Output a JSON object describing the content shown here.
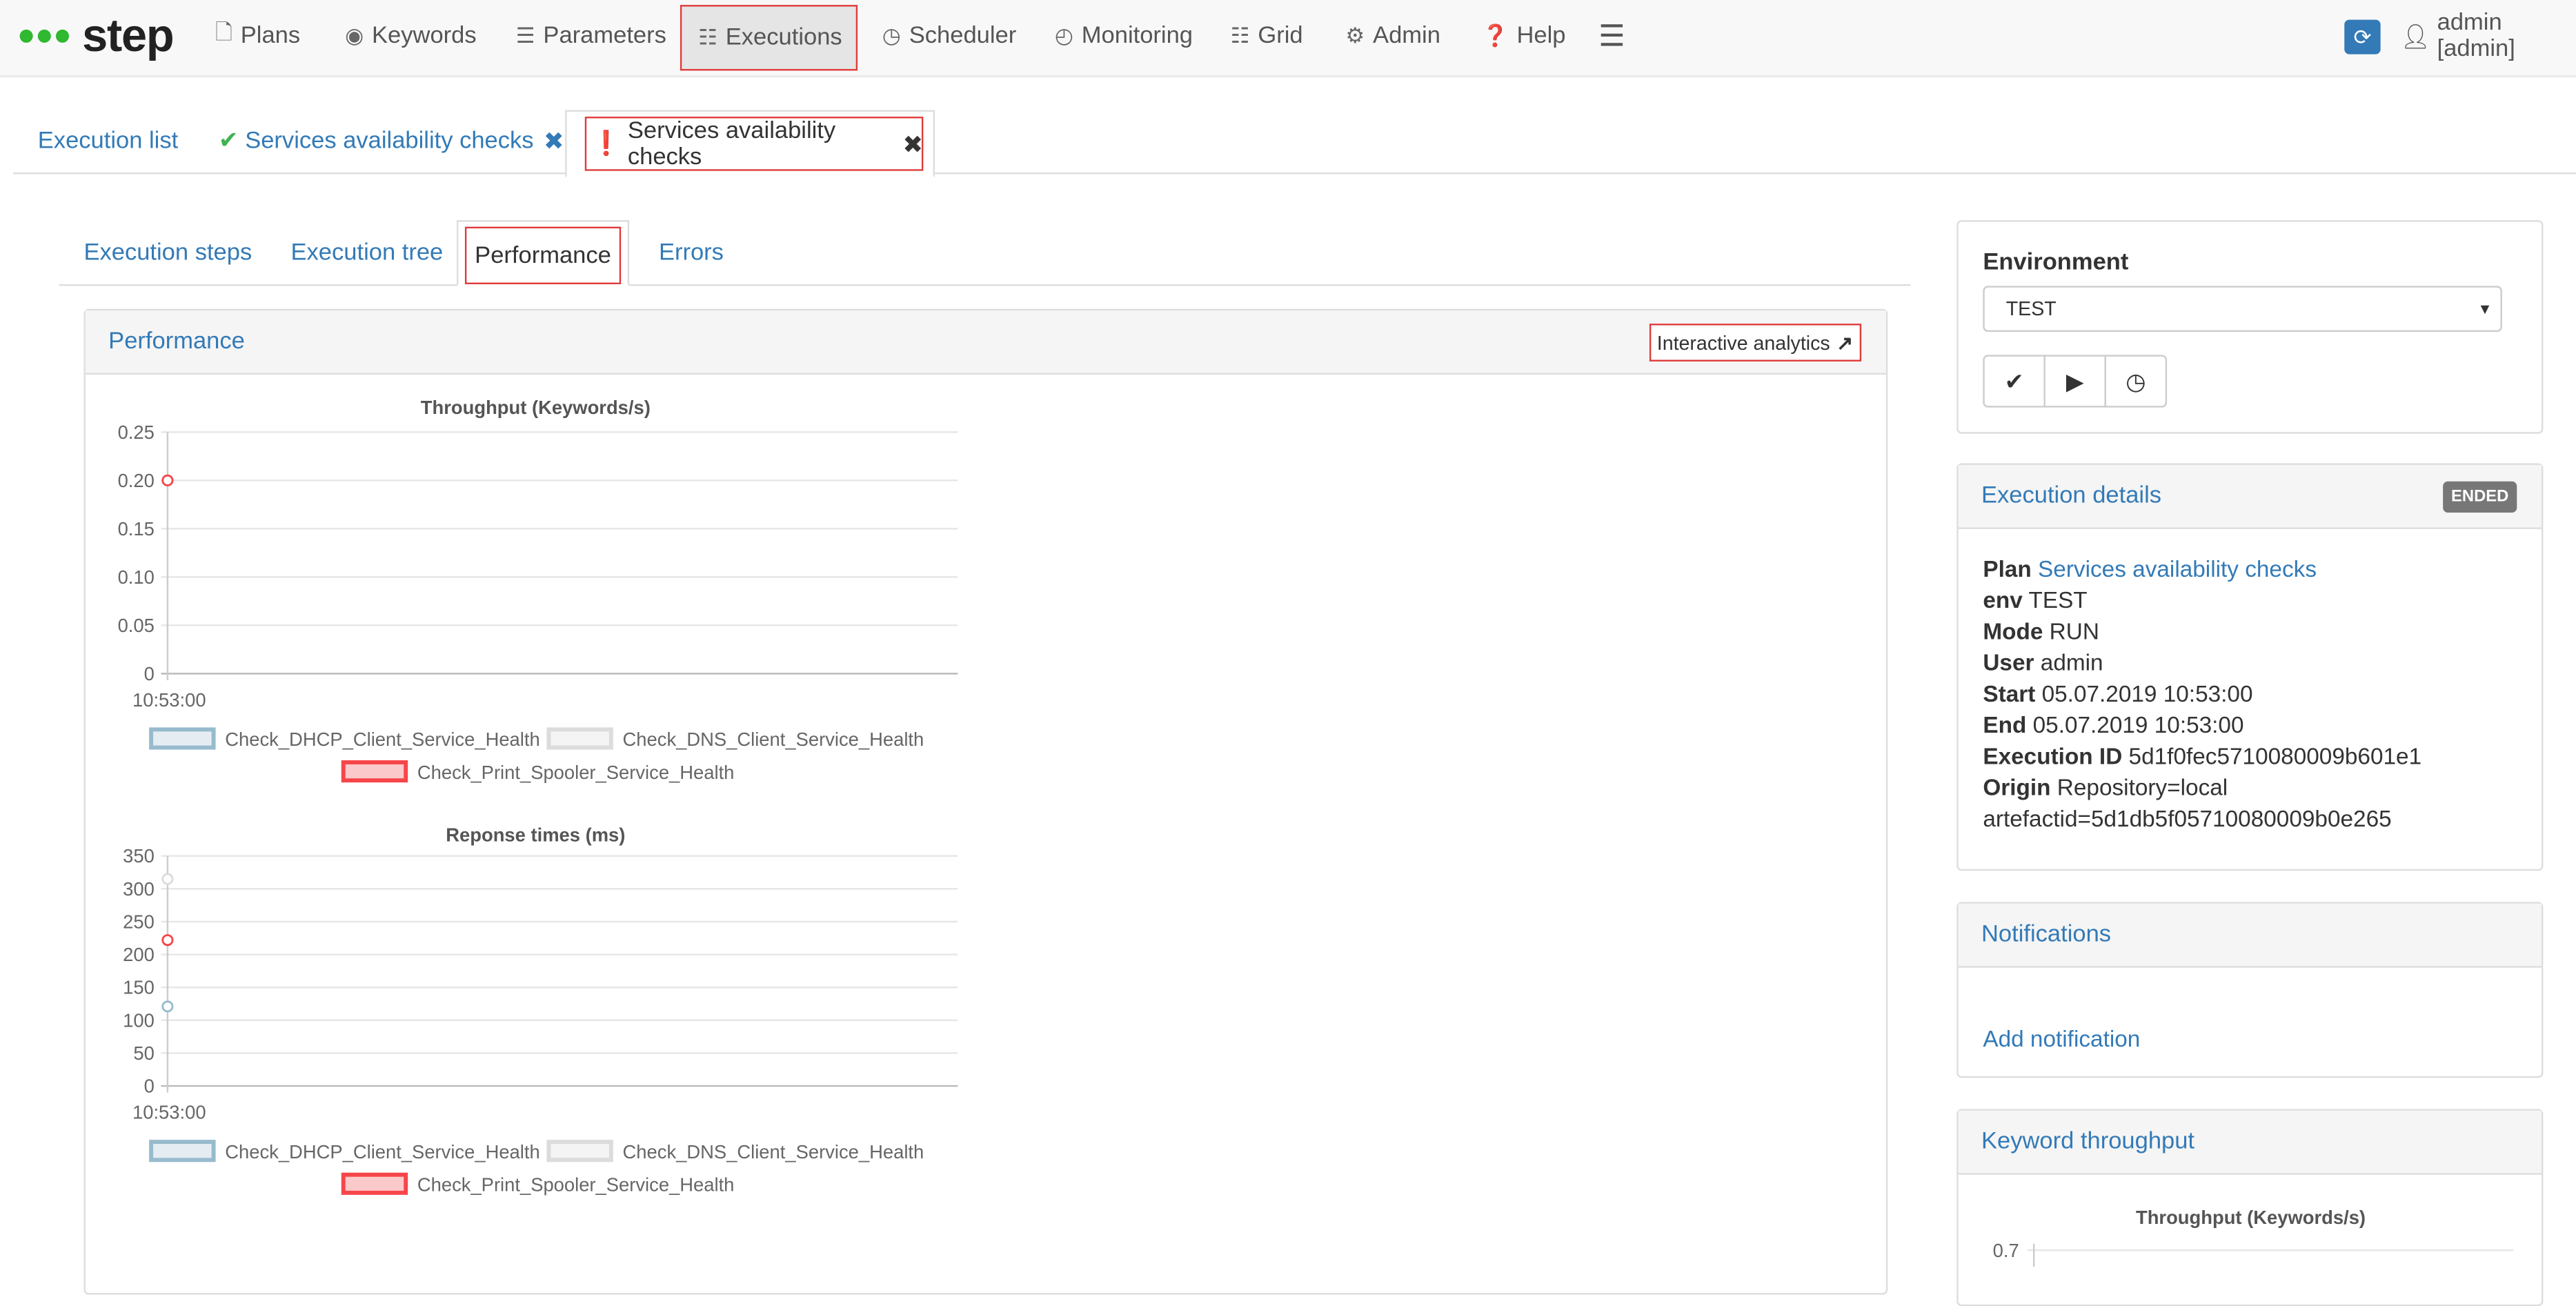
{
  "brand": {
    "name": "step"
  },
  "nav": {
    "items": [
      {
        "label": "Plans",
        "icon": "file-icon"
      },
      {
        "label": "Keywords",
        "icon": "dot-circle-icon"
      },
      {
        "label": "Parameters",
        "icon": "list-icon"
      },
      {
        "label": "Executions",
        "icon": "tasks-icon"
      },
      {
        "label": "Scheduler",
        "icon": "clock-icon"
      },
      {
        "label": "Monitoring",
        "icon": "dashboard-icon"
      },
      {
        "label": "Grid",
        "icon": "grid-icon"
      },
      {
        "label": "Admin",
        "icon": "gear-icon"
      },
      {
        "label": "Help",
        "icon": "question-circle-icon"
      }
    ],
    "active": "Executions",
    "user": "admin [admin]"
  },
  "top_tabs": [
    {
      "label": "Execution list"
    },
    {
      "label": "Services availability checks",
      "status": "passed"
    },
    {
      "label": "Services availability checks",
      "status": "error",
      "active": true
    }
  ],
  "sub_tabs": [
    {
      "label": "Execution steps"
    },
    {
      "label": "Execution tree"
    },
    {
      "label": "Performance",
      "active": true
    },
    {
      "label": "Errors"
    }
  ],
  "performance": {
    "title": "Performance",
    "interactive_label": "Interactive analytics"
  },
  "legend": [
    {
      "name": "Check_DHCP_Client_Service_Health",
      "color": "#97bbcd",
      "fill": "#e5edf2"
    },
    {
      "name": "Check_DNS_Client_Service_Health",
      "color": "#dcdcdc",
      "fill": "#f4f4f4"
    },
    {
      "name": "Check_Print_Spooler_Service_Health",
      "color": "#f7464a",
      "fill": "#fcc9ca"
    }
  ],
  "chart_data": [
    {
      "type": "line",
      "title": "Throughput (Keywords/s)",
      "x": [
        "10:53:00"
      ],
      "yticks": [
        "0.25",
        "0.20",
        "0.15",
        "0.10",
        "0.05",
        "0"
      ],
      "ylim": [
        0,
        0.25
      ],
      "grid": true,
      "legend_position": "bottom",
      "series": [
        {
          "name": "Check_DHCP_Client_Service_Health",
          "values": [
            0.2
          ]
        },
        {
          "name": "Check_DNS_Client_Service_Health",
          "values": [
            0.2
          ]
        },
        {
          "name": "Check_Print_Spooler_Service_Health",
          "values": [
            0.2
          ]
        }
      ]
    },
    {
      "type": "line",
      "title": "Reponse times (ms)",
      "x": [
        "10:53:00"
      ],
      "yticks": [
        "350",
        "300",
        "250",
        "200",
        "150",
        "100",
        "50",
        "0"
      ],
      "ylim": [
        0,
        350
      ],
      "grid": true,
      "legend_position": "bottom",
      "series": [
        {
          "name": "Check_DHCP_Client_Service_Health",
          "values": [
            121
          ]
        },
        {
          "name": "Check_DNS_Client_Service_Health",
          "values": [
            315
          ]
        },
        {
          "name": "Check_Print_Spooler_Service_Health",
          "values": [
            222
          ]
        }
      ]
    },
    {
      "type": "line",
      "title": "Throughput (Keywords/s)",
      "yticks": [
        "0.7"
      ],
      "ylim": [
        0,
        0.7
      ],
      "series": []
    }
  ],
  "environment": {
    "label": "Environment",
    "value": "TEST"
  },
  "execution_details": {
    "title": "Execution details",
    "badge": "ENDED",
    "rows": [
      {
        "key": "Plan",
        "value": "Services availability checks"
      },
      {
        "key": "env",
        "value": "TEST"
      },
      {
        "key": "Mode",
        "value": "RUN"
      },
      {
        "key": "User",
        "value": "admin"
      },
      {
        "key": "Start",
        "value": "05.07.2019 10:53:00"
      },
      {
        "key": "End",
        "value": "05.07.2019 10:53:00"
      },
      {
        "key": "Execution ID",
        "value": "5d1f0fec5710080009b601e1"
      },
      {
        "key": "Origin",
        "value": "Repository=local"
      },
      {
        "key": "",
        "value": "artefactid=5d1db5f05710080009b0e265"
      }
    ]
  },
  "notifications": {
    "title": "Notifications",
    "add_label": "Add notification"
  },
  "keyword_throughput": {
    "title": "Keyword throughput"
  }
}
